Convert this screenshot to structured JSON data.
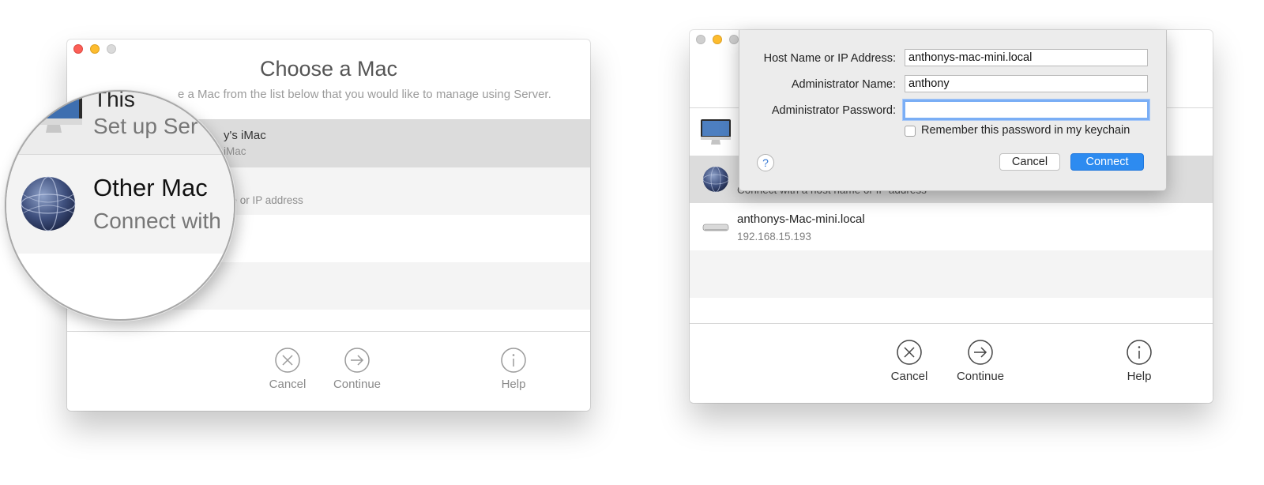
{
  "left_window": {
    "title": "Choose a Mac",
    "subtitle_visible": "e a Mac from the list below that you would like to manage using Server.",
    "rows": [
      {
        "name": "y's iMac",
        "sub": "iMac"
      },
      {
        "name": "",
        "sub": "ne or IP address"
      },
      {
        "name": "",
        "sub": ""
      },
      {
        "name": "",
        "sub": ""
      }
    ],
    "footer": {
      "cancel": "Cancel",
      "continue": "Continue",
      "help": "Help"
    }
  },
  "magnifier": {
    "top_fragment": "This",
    "setup_fragment": "Set up Ser",
    "other_name": "Other Mac",
    "other_sub": "Connect with"
  },
  "right_window": {
    "rows": [
      {
        "name": "",
        "sub": ""
      },
      {
        "name": "",
        "sub": "Connect with a host name or IP address"
      },
      {
        "name": "anthonys-Mac-mini.local",
        "sub": "192.168.15.193"
      },
      {
        "name": "",
        "sub": ""
      }
    ],
    "footer": {
      "cancel": "Cancel",
      "continue": "Continue",
      "help": "Help"
    }
  },
  "dialog": {
    "host_label": "Host Name or IP Address:",
    "host_value": "anthonys-mac-mini.local",
    "admin_label": "Administrator Name:",
    "admin_value": "anthony",
    "password_label": "Administrator Password:",
    "password_value": "",
    "remember_label": "Remember this password in my keychain",
    "help_symbol": "?",
    "cancel": "Cancel",
    "connect": "Connect"
  },
  "colors": {
    "accent": "#2d8bf0",
    "close": "#fc5f57",
    "minimize": "#fdbc2e",
    "selected_row": "#dcdcdc"
  }
}
